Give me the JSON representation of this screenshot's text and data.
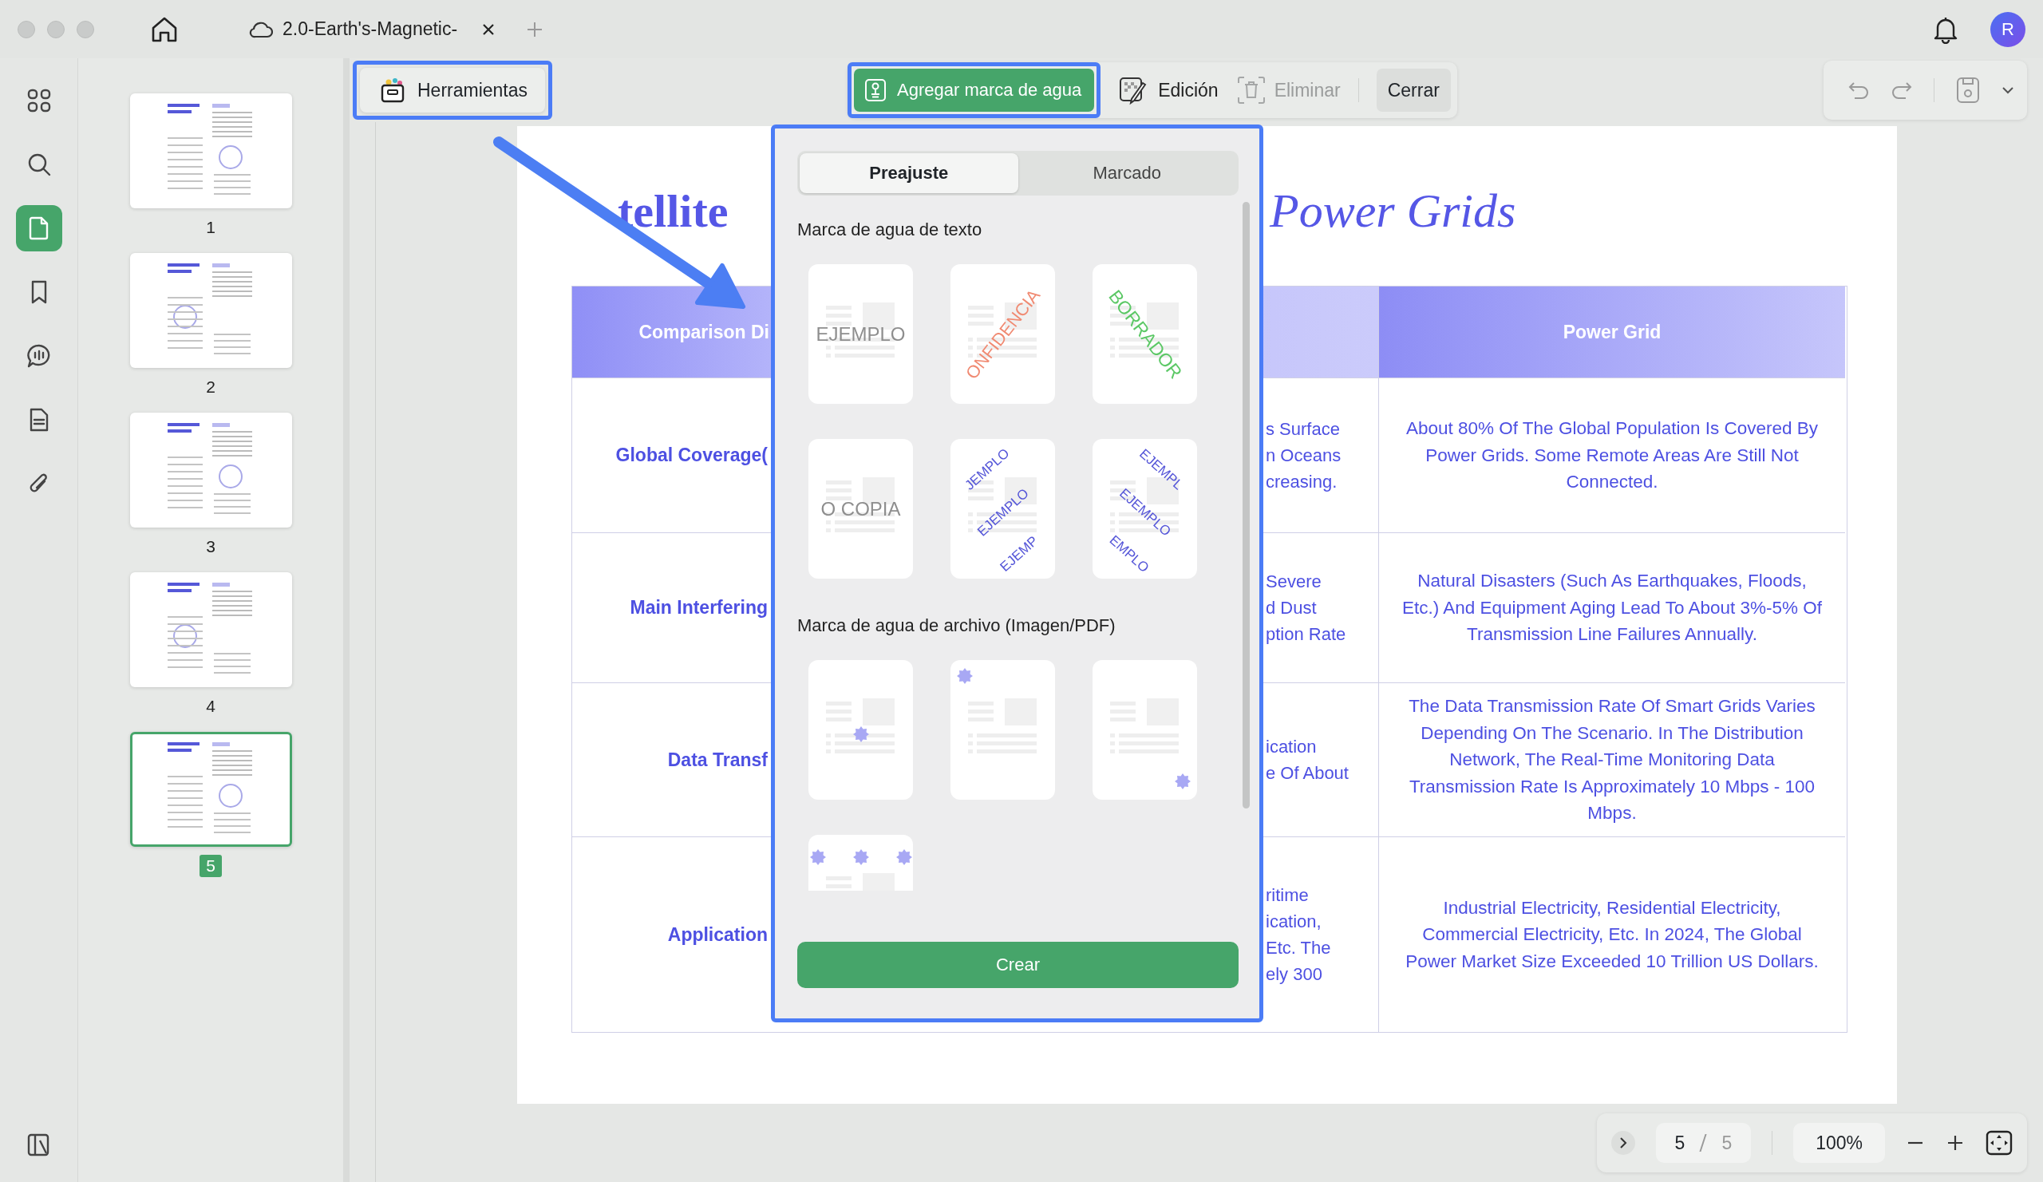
{
  "tab": {
    "title": "2.0-Earth's-Magnetic-"
  },
  "avatar": "R",
  "rail": [
    {
      "kind": "apps",
      "selected": false
    },
    {
      "kind": "search",
      "selected": false
    },
    {
      "kind": "pages",
      "selected": true
    },
    {
      "kind": "bookmark",
      "selected": false
    },
    {
      "kind": "comment",
      "selected": false
    },
    {
      "kind": "document",
      "selected": false
    },
    {
      "kind": "attachment",
      "selected": false
    }
  ],
  "thumbnails": [
    {
      "number": "1",
      "selected": false
    },
    {
      "number": "2",
      "selected": false
    },
    {
      "number": "3",
      "selected": false
    },
    {
      "number": "4",
      "selected": false
    },
    {
      "number": "5",
      "selected": true
    }
  ],
  "toolbar": {
    "tools": "Herramientas",
    "watermark": "Agregar marca de agua",
    "edit": "Edición",
    "delete": {
      "label": "Eliminar",
      "disabled": true
    },
    "close": "Cerrar"
  },
  "document": {
    "title_left": "tellite",
    "title_right": "Power Grids",
    "columns": [
      "Comparison Di",
      "Power Grid"
    ],
    "rows": [
      {
        "label": "Global Coverage(",
        "column_2": [
          "s Surface",
          "n Oceans",
          "creasing."
        ],
        "power_grid": "About 80% Of The Global Population Is Covered By Power Grids. Some Remote Areas Are Still Not Connected."
      },
      {
        "label": "Main Interfering",
        "column_2": [
          "Severe",
          "d Dust",
          "ption Rate"
        ],
        "power_grid": "Natural Disasters (Such As Earthquakes, Floods, Etc.) And Equipment Aging Lead To About 3%-5% Of Transmission Line Failures Annually."
      },
      {
        "label": "Data Transf",
        "column_2": [
          "ication",
          "e Of About"
        ],
        "power_grid": "The Data Transmission Rate Of Smart Grids Varies Depending On The Scenario. In The Distribution Network, The Real-Time Monitoring Data Transmission Rate Is Approximately 10 Mbps - 100 Mbps."
      },
      {
        "label": "Application",
        "column_2": [
          "ritime",
          "ication,",
          "Etc. The",
          "ely 300"
        ],
        "power_grid": "Industrial Electricity, Residential Electricity, Commercial Electricity, Etc. In 2024, The Global Power Market Size Exceeded 10 Trillion US Dollars."
      }
    ]
  },
  "watermark_panel": {
    "tabs": [
      {
        "label": "Preajuste",
        "selected": true
      },
      {
        "label": "Marcado",
        "selected": false
      }
    ],
    "text_heading": "Marca de agua de texto",
    "text_presets": [
      {
        "kind": "center",
        "color": "#8e8e8e",
        "texts": [
          "EJEMPLO"
        ]
      },
      {
        "kind": "diagonal-up",
        "color": "#f08a72",
        "texts": [
          "ONFIDENCIA"
        ]
      },
      {
        "kind": "diagonal-down",
        "color": "#5cc866",
        "texts": [
          "BORRADOR"
        ]
      },
      {
        "kind": "center",
        "color": "#8e8e8e",
        "texts": [
          "O COPIA"
        ]
      },
      {
        "kind": "tiled-up",
        "color": "#5556d8",
        "texts": [
          "JEMPLO",
          "EJEMPLO",
          "EJEMP"
        ]
      },
      {
        "kind": "tiled-down",
        "color": "#5556d8",
        "texts": [
          "EJEMPL",
          "EJEMPLO",
          "EMPLO"
        ]
      }
    ],
    "file_heading": "Marca de agua de archivo (Imagen/PDF)",
    "file_presets": [
      {
        "kind": "center"
      },
      {
        "kind": "top-left"
      },
      {
        "kind": "bottom-right"
      },
      {
        "kind": "tiled"
      }
    ],
    "create": "Crear"
  },
  "footer": {
    "page": "5",
    "total": "5",
    "zoom": "100%"
  }
}
